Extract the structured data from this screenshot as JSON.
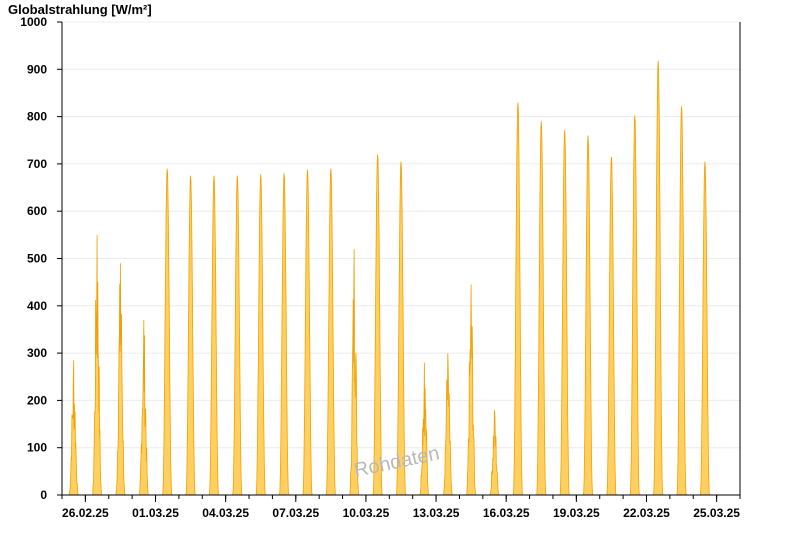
{
  "chart_data": {
    "type": "area",
    "title": "Globalstrahlung [W/m²]",
    "ylim": [
      0,
      1000
    ],
    "y_ticks": [
      0,
      100,
      200,
      300,
      400,
      500,
      600,
      700,
      800,
      900,
      1000
    ],
    "x_start": "25.02.25",
    "x_end": "26.03.25",
    "x_ticks": [
      "26.02.25",
      "01.03.25",
      "04.03.25",
      "07.03.25",
      "10.03.25",
      "13.03.25",
      "16.03.25",
      "19.03.25",
      "22.03.25",
      "25.03.25"
    ],
    "grid": true,
    "fill_color": "#ffd060",
    "line_color": "#f0a000",
    "watermark": "Rohdaten",
    "series": [
      {
        "daily_peaks": [
          {
            "date": "25.02.25",
            "value": 285
          },
          {
            "date": "26.02.25",
            "value": 550
          },
          {
            "date": "27.02.25",
            "value": 490
          },
          {
            "date": "28.02.25",
            "value": 370
          },
          {
            "date": "01.03.25",
            "value": 690
          },
          {
            "date": "02.03.25",
            "value": 675
          },
          {
            "date": "03.03.25",
            "value": 675
          },
          {
            "date": "04.03.25",
            "value": 675
          },
          {
            "date": "05.03.25",
            "value": 678
          },
          {
            "date": "06.03.25",
            "value": 680
          },
          {
            "date": "07.03.25",
            "value": 688
          },
          {
            "date": "08.03.25",
            "value": 690
          },
          {
            "date": "09.03.25",
            "value": 520
          },
          {
            "date": "10.03.25",
            "value": 720
          },
          {
            "date": "11.03.25",
            "value": 705
          },
          {
            "date": "12.03.25",
            "value": 280
          },
          {
            "date": "13.03.25",
            "value": 300
          },
          {
            "date": "14.03.25",
            "value": 445
          },
          {
            "date": "15.03.25",
            "value": 180
          },
          {
            "date": "16.03.25",
            "value": 830
          },
          {
            "date": "17.03.25",
            "value": 790
          },
          {
            "date": "18.03.25",
            "value": 772
          },
          {
            "date": "19.03.25",
            "value": 760
          },
          {
            "date": "20.03.25",
            "value": 715
          },
          {
            "date": "21.03.25",
            "value": 803
          },
          {
            "date": "22.03.25",
            "value": 918
          },
          {
            "date": "23.03.25",
            "value": 822
          },
          {
            "date": "24.03.25",
            "value": 705
          }
        ]
      }
    ]
  }
}
